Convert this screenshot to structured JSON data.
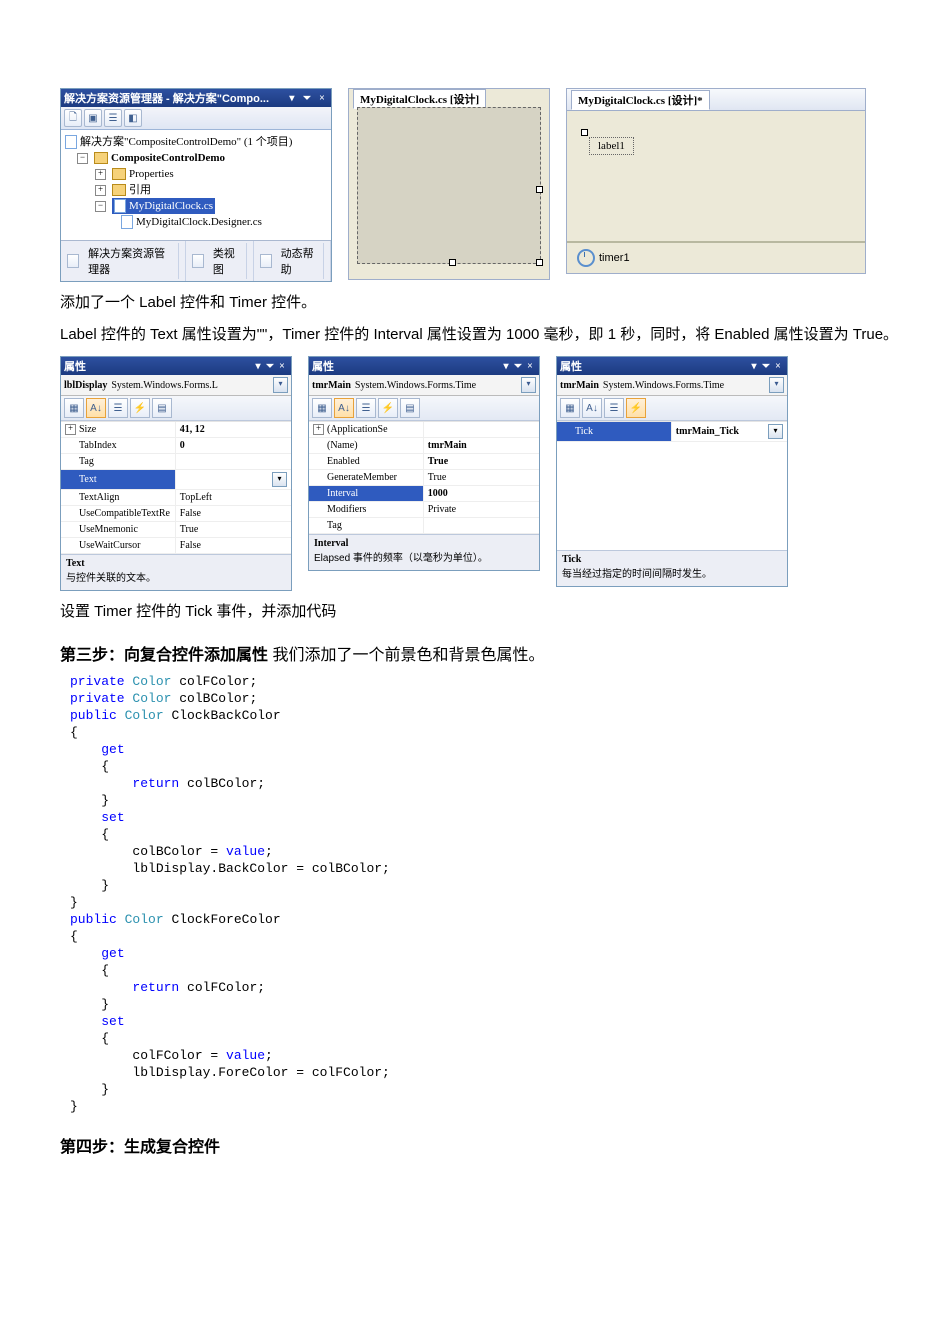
{
  "explorer": {
    "title": "解决方案资源管理器 - 解决方案\"Compo...",
    "root": "解决方案\"CompositeControlDemo\" (1 个项目)",
    "proj": "CompositeControlDemo",
    "n1": "Properties",
    "n2": "引用",
    "n3": "MyDigitalClock.cs",
    "n4": "MyDigitalClock.Designer.cs",
    "tabs": {
      "t1": "解决方案资源管理器",
      "t2": "类视图",
      "t3": "动态帮助"
    }
  },
  "designA": {
    "tab": "MyDigitalClock.cs [设计]"
  },
  "designB": {
    "tab": "MyDigitalClock.cs [设计]*",
    "label": "label1",
    "timer": "timer1"
  },
  "p1": "添加了一个 Label 控件和 Timer 控件。",
  "p2": "Label 控件的 Text 属性设置为\"\"，Timer 控件的 Interval 属性设置为 1000 毫秒，即 1 秒，同时，将 Enabled 属性设置为 True。",
  "propTitle": "属性",
  "propA": {
    "obj": "lblDisplay System.Windows.Forms.L",
    "rows": [
      {
        "n": "Size",
        "v": "41, 12",
        "exp": "+",
        "bold": true
      },
      {
        "n": "TabIndex",
        "v": "0",
        "bold": true
      },
      {
        "n": "Tag",
        "v": ""
      },
      {
        "n": "Text",
        "v": "",
        "sel": true,
        "dd": true
      },
      {
        "n": "TextAlign",
        "v": "TopLeft"
      },
      {
        "n": "UseCompatibleTextRe",
        "v": "False"
      },
      {
        "n": "UseMnemonic",
        "v": "True"
      },
      {
        "n": "UseWaitCursor",
        "v": "False"
      }
    ],
    "d1": "Text",
    "d2": "与控件关联的文本。"
  },
  "propB": {
    "obj": "tmrMain System.Windows.Forms.Time",
    "rows": [
      {
        "n": "(ApplicationSe",
        "v": "",
        "exp": "+"
      },
      {
        "n": "(Name)",
        "v": "tmrMain",
        "bold": true
      },
      {
        "n": "Enabled",
        "v": "True",
        "bold": true
      },
      {
        "n": "GenerateMember",
        "v": "True"
      },
      {
        "n": "Interval",
        "v": "1000",
        "sel": true,
        "bold": true
      },
      {
        "n": "Modifiers",
        "v": "Private"
      },
      {
        "n": "Tag",
        "v": ""
      }
    ],
    "d1": "Interval",
    "d2": "Elapsed 事件的频率（以毫秒为单位）。"
  },
  "propC": {
    "obj": "tmrMain System.Windows.Forms.Time",
    "rows": [
      {
        "n": "Tick",
        "v": "tmrMain_Tick",
        "sel": true,
        "bold": true,
        "dd": true
      }
    ],
    "d1": "Tick",
    "d2": "每当经过指定的时间间隔时发生。"
  },
  "p3": "设置 Timer 控件的 Tick 事件，并添加代码",
  "s3a": "第三步：向复合控件添加属性",
  "s3b": "  我们添加了一个前景色和背景色属性。",
  "code": "private Color colFColor;\nprivate Color colBColor;\npublic Color ClockBackColor\n{\n    get\n    {\n        return colBColor;\n    }\n    set\n    {\n        colBColor = value;\n        lblDisplay.BackColor = colBColor;\n    }\n}\npublic Color ClockForeColor\n{\n    get\n    {\n        return colFColor;\n    }\n    set\n    {\n        colFColor = value;\n        lblDisplay.ForeColor = colFColor;\n    }\n}",
  "s4": "第四步：生成复合控件"
}
